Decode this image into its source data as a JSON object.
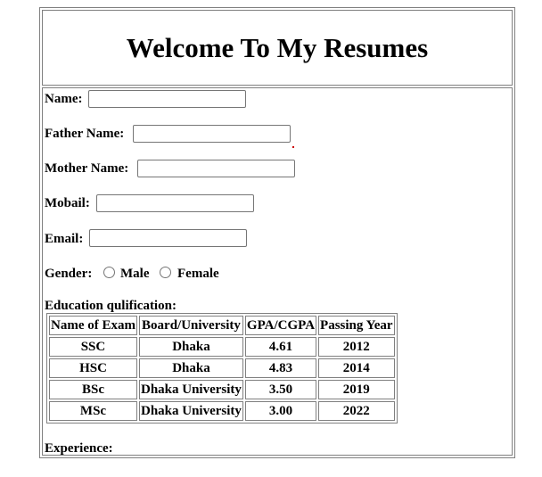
{
  "header": {
    "title": "Welcome To My Resumes"
  },
  "form": {
    "name_label": "Name:",
    "father_label": "Father Name:",
    "mother_label": "Mother Name:",
    "mobile_label": "Mobail:",
    "email_label": "Email:",
    "gender_label": "Gender:",
    "gender_options": [
      "Male",
      "Female"
    ],
    "name_value": "",
    "father_value": "",
    "mother_value": "",
    "mobile_value": "",
    "email_value": ""
  },
  "education": {
    "title": "Education qulification:",
    "columns": [
      "Name of Exam",
      "Board/University",
      "GPA/CGPA",
      "Passing Year"
    ],
    "rows": [
      [
        "SSC",
        "Dhaka",
        "4.61",
        "2012"
      ],
      [
        "HSC",
        "Dhaka",
        "4.83",
        "2014"
      ],
      [
        "BSc",
        "Dhaka University",
        "3.50",
        "2019"
      ],
      [
        "MSc",
        "Dhaka University",
        "3.00",
        "2022"
      ]
    ]
  },
  "experience": {
    "label": "Experience:"
  },
  "colors": {
    "border": "#808080",
    "input_border": "#767676",
    "text": "#000000",
    "background": "#ffffff",
    "stray_mark": "#cc0000"
  }
}
